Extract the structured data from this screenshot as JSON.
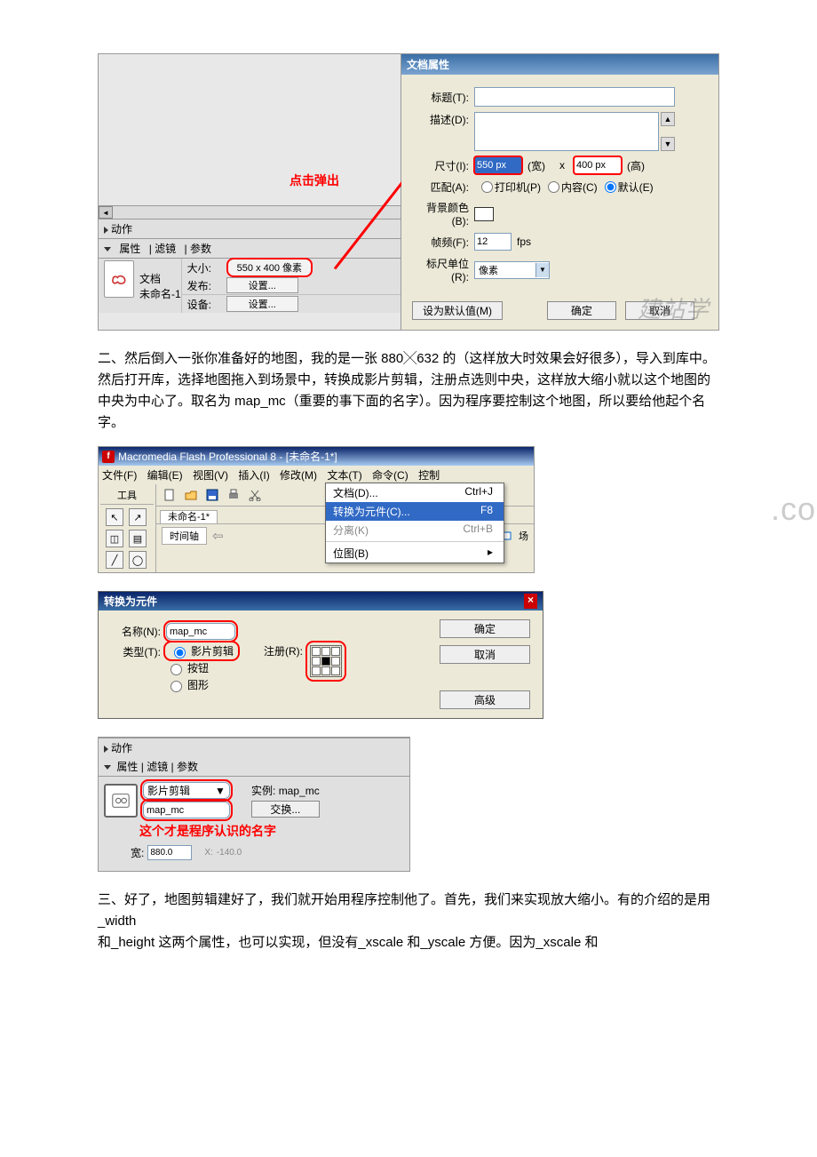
{
  "fig1": {
    "click_label": "点击弹出",
    "actions_tab": "动作",
    "tabs": {
      "props": "属性",
      "filters": "滤镜",
      "params": "参数"
    },
    "inspector": {
      "doc": "文档",
      "untitled": "未命名-1",
      "size_lbl": "大小:",
      "size_val": "550 x 400 像素",
      "publish_lbl": "发布:",
      "device_lbl": "设备:",
      "settings": "设置..."
    },
    "dialog": {
      "title": "文档属性",
      "title_lbl": "标题(T):",
      "desc_lbl": "描述(D):",
      "dim_lbl": "尺寸(I):",
      "dim_w": "550 px",
      "dim_wu": "(宽)",
      "dim_x": "x",
      "dim_h": "400 px",
      "dim_hu": "(高)",
      "match_lbl": "匹配(A):",
      "match_printer": "打印机(P)",
      "match_content": "内容(C)",
      "match_default": "默认(E)",
      "bg_lbl": "背景颜色(B):",
      "fps_lbl": "帧频(F):",
      "fps_val": "12",
      "fps_unit": "fps",
      "ruler_lbl": "标尺单位(R):",
      "ruler_val": "像素",
      "set_default": "设为默认值(M)",
      "ok": "确定",
      "cancel": "取消"
    },
    "watermark": "建站学"
  },
  "para1": "二、然后倒入一张你准备好的地图，我的是一张 880╳632 的（这样放大时效果会好很多），导入到库中。然后打开库，选择地图拖入到场景中，转换成影片剪辑，注册点选则中央，这样放大缩小就以这个地图的中央为中心了。取名为 map_mc（重要的事下面的名字）。因为程序要控制这个地图，所以要给他起个名字。",
  "fig2": {
    "ide_title": "Macromedia Flash Professional 8 - [未命名-1*]",
    "menus": {
      "file": "文件(F)",
      "edit": "编辑(E)",
      "view": "视图(V)",
      "insert": "插入(I)",
      "modify": "修改(M)",
      "text": "文本(T)",
      "cmd": "命令(C)",
      "ctrl": "控制"
    },
    "tools_lbl": "工具",
    "doc_tab": "未命名-1*",
    "timeline_lbl": "时间轴",
    "scene_lbl": "场",
    "menu_items": {
      "document": "文档(D)...",
      "document_sc": "Ctrl+J",
      "convert": "转换为元件(C)...",
      "convert_sc": "F8",
      "break": "分离(K)",
      "break_sc": "Ctrl+B",
      "bitmap": "位图(B)"
    },
    "watermark": ".com"
  },
  "fig3": {
    "title": "转换为元件",
    "name_lbl": "名称(N):",
    "name_val": "map_mc",
    "type_lbl": "类型(T):",
    "type_mc": "影片剪辑",
    "type_btn": "按钮",
    "type_gfx": "图形",
    "reg_lbl": "注册(R):",
    "ok": "确定",
    "cancel": "取消",
    "adv": "高级"
  },
  "fig4": {
    "actions_tab": "动作",
    "tabs": {
      "props": "属性",
      "filters": "滤镜",
      "params": "参数"
    },
    "mc_label": "影片剪辑",
    "instance_name": "map_mc",
    "inst_lbl": "实例:",
    "inst_val": "map_mc",
    "swap_btn": "交换...",
    "note": "这个才是程序认识的名字",
    "w_lbl": "宽:",
    "w_val": "880.0",
    "x_lbl": "X:",
    "x_val": "-140.0"
  },
  "para2": "三、好了，地图剪辑建好了，我们就开始用程序控制他了。首先，我们来实现放大缩小。有的介绍的是用_width",
  "para3": "和_height 这两个属性，也可以实现，但没有_xscale 和_yscale 方便。因为_xscale 和"
}
